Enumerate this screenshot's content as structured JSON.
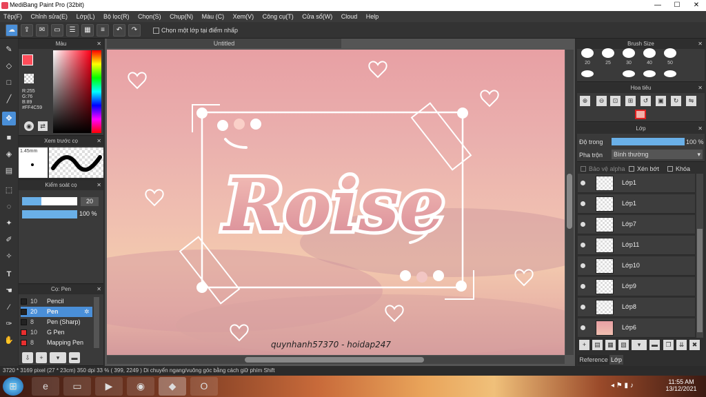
{
  "window": {
    "title": "MediBang Paint Pro (32bit)",
    "min": "—",
    "max": "☐",
    "close": "✕"
  },
  "menu": [
    "Tệp(F)",
    "Chỉnh sửa(E)",
    "Lớp(L)",
    "Bộ lọc(R)",
    "Chọn(S)",
    "Chụp(N)",
    "Màu (C)",
    "Xem(V)",
    "Công cụ(T)",
    "Cửa sổ(W)",
    "Cloud",
    "Help"
  ],
  "toolbar": {
    "checkbox_label": "Chọn một lớp tại điểm nhấp"
  },
  "canvas_tab": "Untitled",
  "color_panel": {
    "title": "Màu",
    "r": "R:255",
    "g": "G:76",
    "b": "B:89",
    "hex": "#FF4C59",
    "primary": "#FF4C59"
  },
  "preview_panel": {
    "title": "Xem trước cọ",
    "size": "1.45mm"
  },
  "brush_control": {
    "title": "Kiểm soát cọ",
    "size_val": "20",
    "opacity_val": "100 %",
    "size_fraction": 0.35,
    "opacity_fraction": 1.0
  },
  "pen_panel": {
    "title": "Cọ: Pen",
    "items": [
      {
        "num": "10",
        "name": "Pencil",
        "color": "#222222"
      },
      {
        "num": "20",
        "name": "Pen",
        "color": "#222222",
        "selected": true
      },
      {
        "num": "8",
        "name": "Pen (Sharp)",
        "color": "#222222"
      },
      {
        "num": "10",
        "name": "G Pen",
        "color": "#e83030"
      },
      {
        "num": "8",
        "name": "Mapping Pen",
        "color": "#e83030"
      }
    ]
  },
  "brush_size": {
    "title": "Brush Size",
    "sizes": [
      "20",
      "25",
      "30",
      "40",
      "50"
    ]
  },
  "navigator": {
    "title": "Hoa tiêu"
  },
  "layer_panel": {
    "title": "Lớp",
    "opacity_label": "Độ trong",
    "opacity_val": "100 %",
    "opacity_fraction": 1.0,
    "blend_label": "Pha trộn",
    "blend_val": "Bình thường",
    "protect_alpha": "Bảo vệ alpha",
    "clipping": "Xén bớt",
    "lock": "Khóa",
    "layers": [
      "Lớp1",
      "Lớp1",
      "Lớp7",
      "Lớp11",
      "Lớp10",
      "Lớp9",
      "Lớp8",
      "Lớp6"
    ]
  },
  "bottom_tabs": [
    "Reference",
    "Lớp"
  ],
  "artwork": {
    "title_text": "Roise",
    "signature": "quynhanh57370 - hoidap247"
  },
  "status": {
    "text": "3720 * 3169 pixel   (27 * 23cm)   350 dpi   33 %   ( 399, 2249 )   Di chuyển ngang/vuông góc bằng cách giữ phím Shift"
  },
  "taskbar": {
    "time": "11:55 AM",
    "date": "13/12/2021"
  }
}
